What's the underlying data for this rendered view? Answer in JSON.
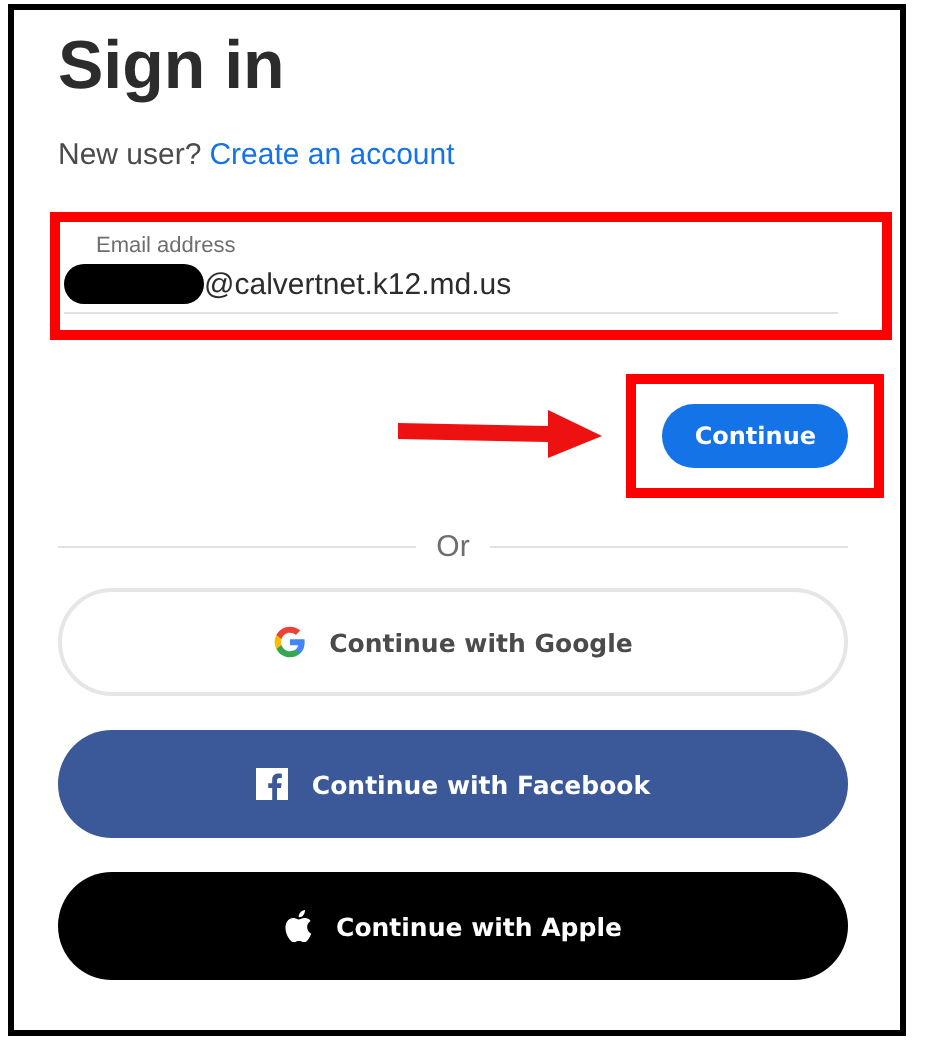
{
  "title": "Sign in",
  "new_user": {
    "prompt": "New user?",
    "link": "Create an account"
  },
  "email_field": {
    "label": "Email address",
    "value": "@calvertnet.k12.md.us",
    "redacted": true,
    "highlighted": true
  },
  "continue_button": {
    "label": "Continue",
    "highlighted": true,
    "arrow": true
  },
  "divider": "Or",
  "social_buttons": [
    {
      "kind": "google",
      "label": "Continue with Google"
    },
    {
      "kind": "facebook",
      "label": "Continue with Facebook"
    },
    {
      "kind": "apple",
      "label": "Continue with Apple"
    }
  ]
}
